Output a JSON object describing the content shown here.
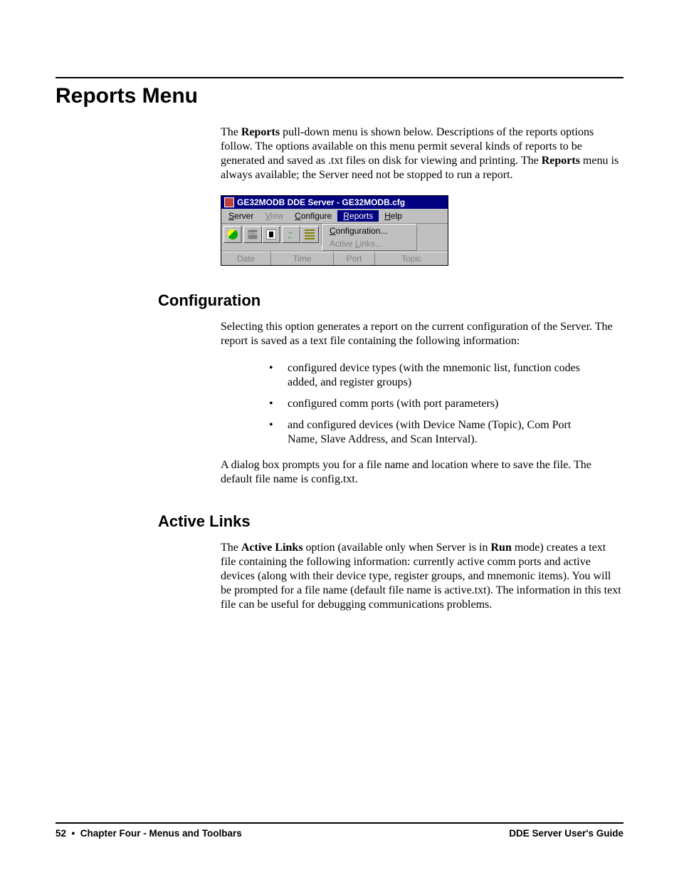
{
  "heading": "Reports Menu",
  "intro": {
    "pre1": "The ",
    "b1": "Reports",
    "mid1": " pull-down menu is shown below. Descriptions of the reports options follow. The options available on this menu permit several kinds of reports to be generated and saved as .txt files on disk for viewing and printing. The ",
    "b2": "Reports",
    "post1": " menu is always available; the Server need not be stopped to run a report."
  },
  "screenshot": {
    "title": "GE32MODB DDE Server - GE32MODB.cfg",
    "menus": {
      "server": "Server",
      "view": "View",
      "configure": "Configure",
      "reports": "Reports",
      "help": "Help"
    },
    "dropdown": {
      "configuration": "Configuration...",
      "active_links": "Active Links..."
    },
    "status": {
      "date": "Date",
      "time": "Time",
      "port": "Port",
      "topic": "Topic"
    }
  },
  "section_config": {
    "title": "Configuration",
    "p1": "Selecting this option generates a report on the current configuration of the Server. The report is saved as a text file containing the following information:",
    "bullets": [
      "configured device types (with the mnemonic list, function codes added, and register groups)",
      "configured comm ports (with port parameters)",
      "and configured devices (with Device Name (Topic), Com Port Name, Slave Address, and Scan Interval)."
    ],
    "p2": "A dialog box prompts you for a file name and location where to save the file. The default file name is config.txt."
  },
  "section_active": {
    "title": "Active Links",
    "pre": "The ",
    "b1": "Active Links",
    "mid": " option (available only when Server is in ",
    "b2": "Run",
    "post": " mode) creates a text file containing the following information: currently active comm ports and active devices (along with their device type, register groups, and mnemonic items). You will be prompted for a file name (default file name is active.txt). The information in this text file can be useful for debugging communications problems."
  },
  "footer": {
    "page": "52",
    "chapter": "Chapter Four - Menus and Toolbars",
    "guide": "DDE Server User's Guide"
  }
}
